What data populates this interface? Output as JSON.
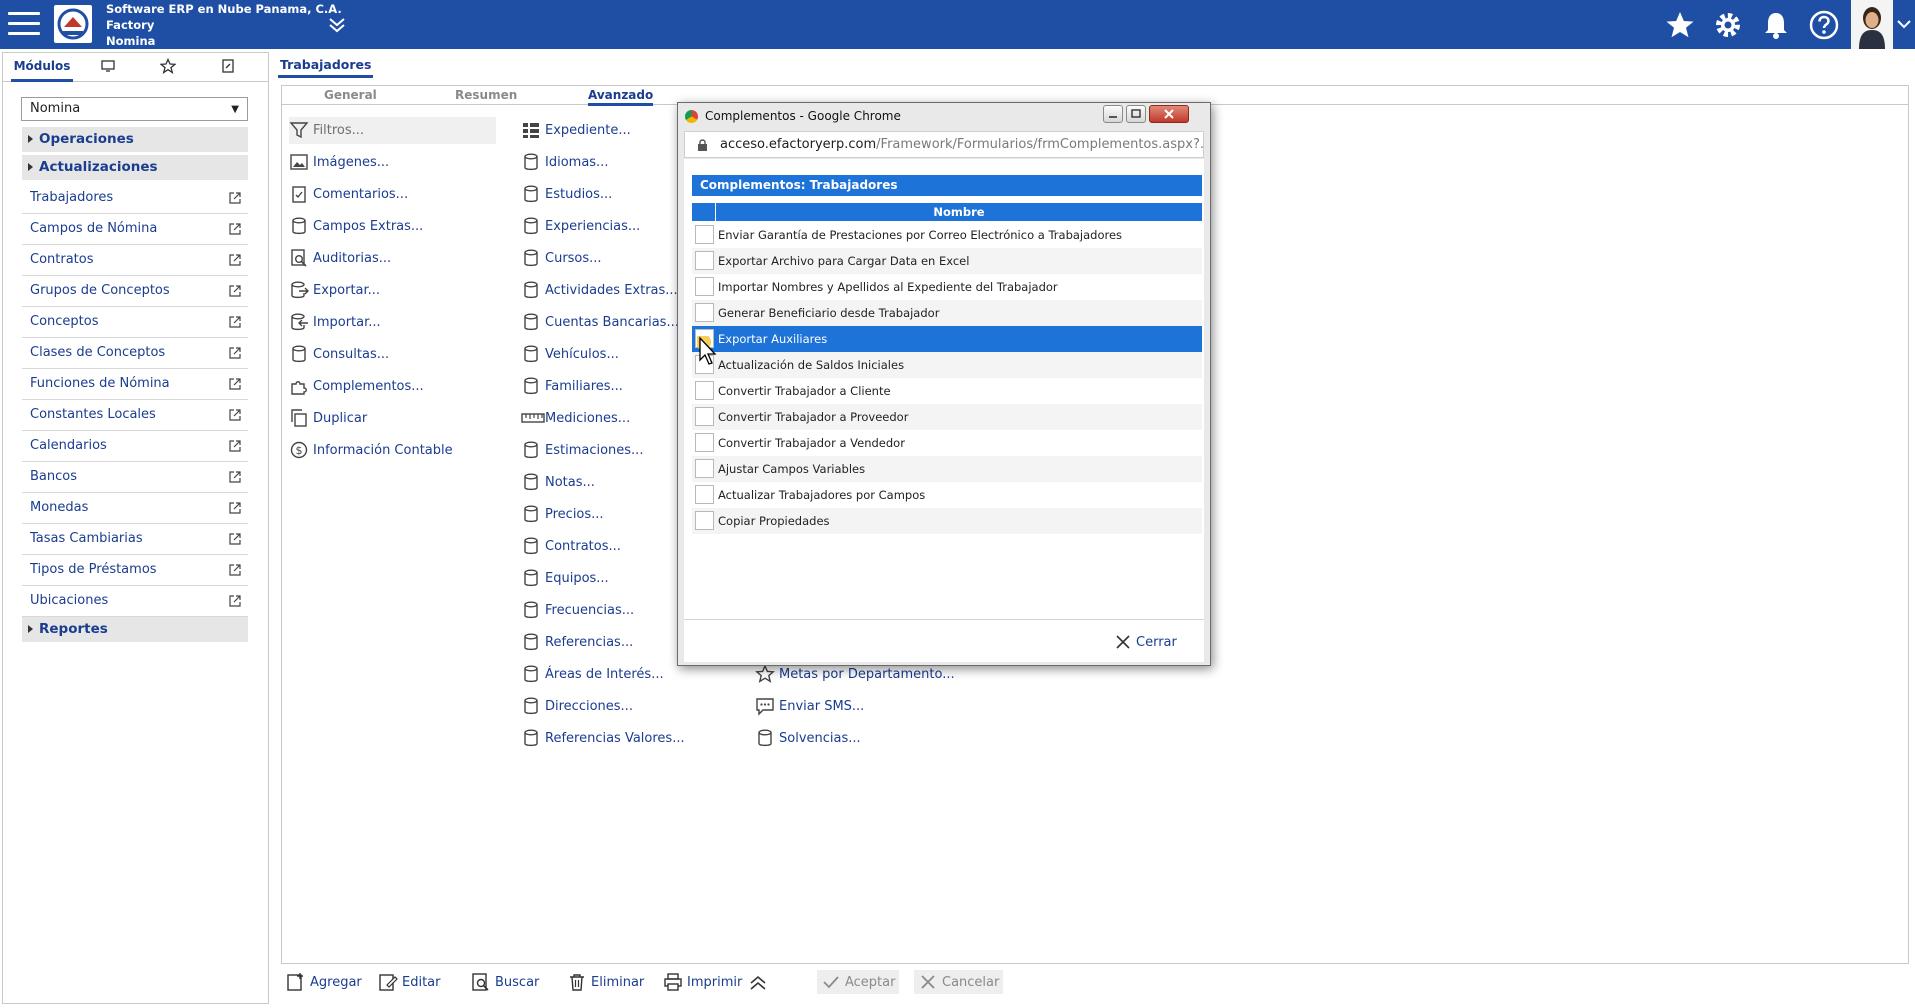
{
  "header": {
    "company_line1": "Software ERP en Nube Panama, C.A.",
    "company_line2": "Factory",
    "company_line3": "Nomina",
    "icons": [
      "hamburger-icon",
      "collapse-icon",
      "star-icon",
      "gear-icon",
      "bell-icon",
      "help-icon"
    ],
    "color": "#1f4fa5"
  },
  "sidebar": {
    "tab_modules": "Módulos",
    "module_value": "Nomina",
    "sections": {
      "operaciones": "Operaciones",
      "actualizaciones": "Actualizaciones",
      "reportes": "Reportes"
    },
    "items": [
      "Trabajadores",
      "Campos de Nómina",
      "Contratos",
      "Grupos de Conceptos",
      "Conceptos",
      "Clases de Conceptos",
      "Funciones de Nómina",
      "Constantes Locales",
      "Calendarios",
      "Bancos",
      "Monedas",
      "Tasas Cambiarias",
      "Tipos de Préstamos",
      "Ubicaciones"
    ]
  },
  "main": {
    "tab": "Trabajadores",
    "subtabs": [
      "General",
      "Resumen",
      "Avanzado"
    ],
    "col1": [
      "Filtros...",
      "Imágenes...",
      "Comentarios...",
      "Campos Extras...",
      "Auditorias...",
      "Exportar...",
      "Importar...",
      "Consultas...",
      "Complementos...",
      "Duplicar",
      "Información Contable"
    ],
    "col2": [
      "Expediente...",
      "Idiomas...",
      "Estudios...",
      "Experiencias...",
      "Cursos...",
      "Actividades Extras...",
      "Cuentas Bancarias...",
      "Vehículos...",
      "Familiares...",
      "Mediciones...",
      "Estimaciones...",
      "Notas...",
      "Precios...",
      "Contratos...",
      "Equipos...",
      "Frecuencias...",
      "Referencias...",
      "Áreas de Interés...",
      "Direcciones...",
      "Referencias Valores..."
    ],
    "col3": [
      "Metas por Departamento...",
      "Enviar SMS...",
      "Solvencias..."
    ]
  },
  "toolbar": {
    "agregar": "Agregar",
    "editar": "Editar",
    "buscar": "Buscar",
    "eliminar": "Eliminar",
    "imprimir": "Imprimir",
    "aceptar": "Aceptar",
    "cancelar": "Cancelar"
  },
  "popup": {
    "window_title": "Complementos - Google Chrome",
    "url_domain": "acceso.efactoryerp.com",
    "url_path": "/Framework/Formularios/frmComplementos.aspx?...",
    "header": "Complementos: Trabajadores",
    "column_name": "Nombre",
    "rows": [
      "Enviar Garantía de Prestaciones por Correo Electrónico a Trabajadores",
      "Exportar Archivo para Cargar Data en Excel",
      "Importar Nombres y Apellidos al Expediente del Trabajador",
      "Generar Beneficiario desde Trabajador",
      "Exportar Auxiliares",
      "Actualización de Saldos Iniciales",
      "Convertir Trabajador a Cliente",
      "Convertir Trabajador a Proveedor",
      "Convertir Trabajador a Vendedor",
      "Ajustar Campos Variables",
      "Actualizar Trabajadores por Campos",
      "Copiar Propiedades"
    ],
    "selected_row": "Exportar Auxiliares",
    "close_label": "Cerrar",
    "accent": "#1e73d8"
  }
}
